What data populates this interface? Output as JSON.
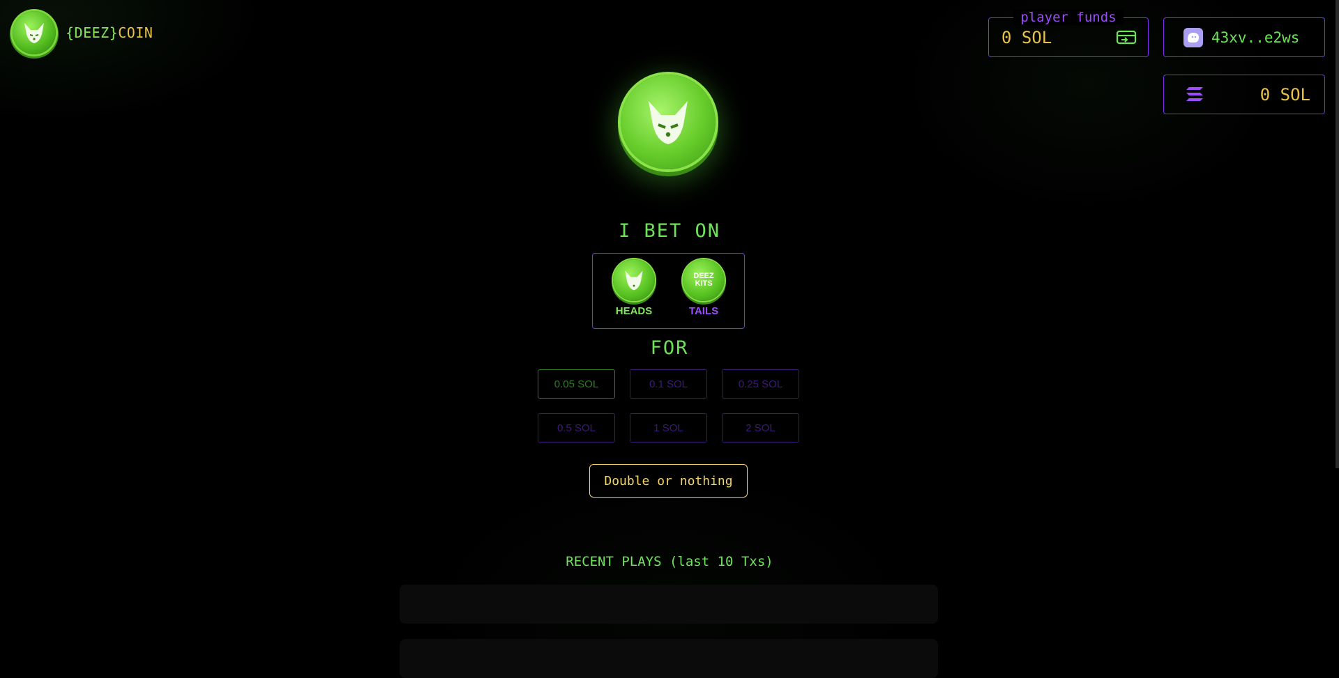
{
  "brand": {
    "name_part1": "{DEEZ}",
    "name_part2": "COIN"
  },
  "funds": {
    "legend": "player funds",
    "value": "0 SOL"
  },
  "wallet": {
    "address": "43xv..e2ws"
  },
  "balance": {
    "value": "0 SOL"
  },
  "bet": {
    "heading": "I BET ON",
    "heads_label": "HEADS",
    "tails_label": "TAILS",
    "tails_mark_top": "DEEZ",
    "tails_mark_bottom": "KITS",
    "for_label": "FOR",
    "amounts": [
      "0.05 SOL",
      "0.1 SOL",
      "0.25 SOL",
      "0.5 SOL",
      "1 SOL",
      "2 SOL"
    ],
    "selected_amount": "0.05 SOL"
  },
  "action": {
    "button_label": "Double or nothing"
  },
  "recent": {
    "title": "RECENT PLAYS (last 10 Txs)"
  },
  "colors": {
    "accent_green": "#6ee35a",
    "accent_purple": "#7c2ff0",
    "accent_gold": "#e9c24a"
  },
  "icons": [
    "fox-logo-icon",
    "card-transfer-icon",
    "phantom-wallet-icon",
    "solana-icon"
  ]
}
